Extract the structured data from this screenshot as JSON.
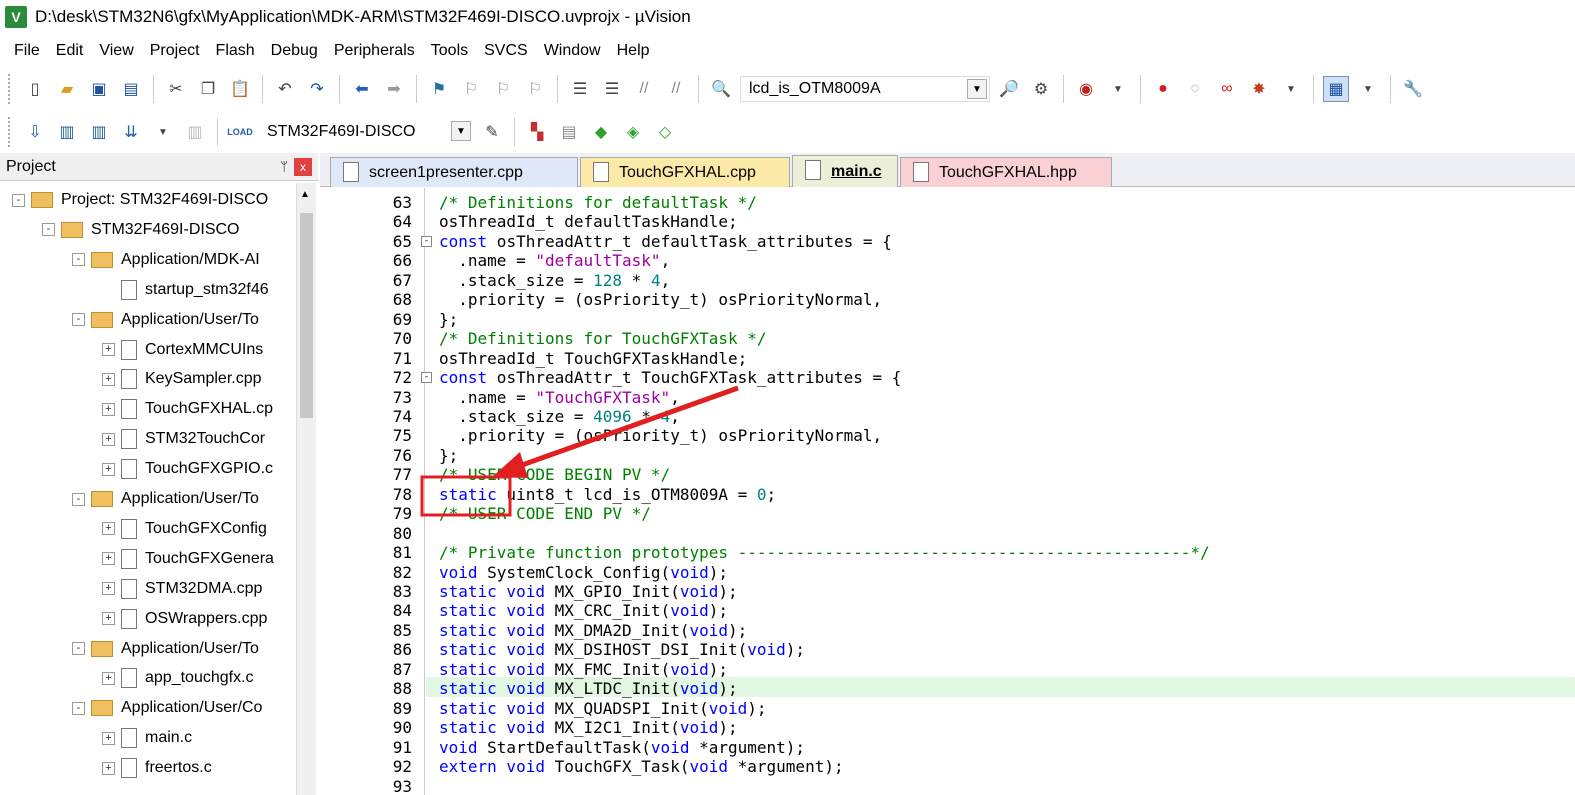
{
  "window": {
    "title": "D:\\desk\\STM32N6\\gfx\\MyApplication\\MDK-ARM\\STM32F469I-DISCO.uvprojx - µVision",
    "icon": "V"
  },
  "menu": [
    "File",
    "Edit",
    "View",
    "Project",
    "Flash",
    "Debug",
    "Peripherals",
    "Tools",
    "SVCS",
    "Window",
    "Help"
  ],
  "toolbar": {
    "find_combo": "lcd_is_OTM8009A",
    "target_combo": "STM32F469I-DISCO"
  },
  "project_panel": {
    "title": "Project",
    "pin": "ᛘ",
    "close": "x"
  },
  "tree": [
    {
      "label": "Project: STM32F469I-DISCO",
      "toggle": "-"
    },
    {
      "label": "STM32F469I-DISCO",
      "toggle": "-"
    },
    {
      "label": "Application/MDK-AI",
      "toggle": "-"
    },
    {
      "label": "startup_stm32f46",
      "toggle": ""
    },
    {
      "label": "Application/User/To",
      "toggle": "-"
    },
    {
      "label": "CortexMMCUIns",
      "toggle": "+"
    },
    {
      "label": "KeySampler.cpp",
      "toggle": "+"
    },
    {
      "label": "TouchGFXHAL.cp",
      "toggle": "+"
    },
    {
      "label": "STM32TouchCor",
      "toggle": "+"
    },
    {
      "label": "TouchGFXGPIO.c",
      "toggle": "+"
    },
    {
      "label": "Application/User/To",
      "toggle": "-"
    },
    {
      "label": "TouchGFXConfig",
      "toggle": "+"
    },
    {
      "label": "TouchGFXGenera",
      "toggle": "+"
    },
    {
      "label": "STM32DMA.cpp",
      "toggle": "+"
    },
    {
      "label": "OSWrappers.cpp",
      "toggle": "+"
    },
    {
      "label": "Application/User/To",
      "toggle": "-"
    },
    {
      "label": "app_touchgfx.c",
      "toggle": "+"
    },
    {
      "label": "Application/User/Co",
      "toggle": "-"
    },
    {
      "label": "main.c",
      "toggle": "+"
    },
    {
      "label": "freertos.c",
      "toggle": "+"
    }
  ],
  "tabs": [
    {
      "label": "screen1presenter.cpp",
      "active": false,
      "color": "#dfe8f8"
    },
    {
      "label": "TouchGFXHAL.cpp",
      "active": false,
      "color": "#fbe9a8"
    },
    {
      "label": "main.c",
      "active": true,
      "color": "#ecf0d8"
    },
    {
      "label": "TouchGFXHAL.hpp",
      "active": false,
      "color": "#f9d0d4"
    }
  ],
  "code": [
    {
      "n": "63",
      "f": "",
      "t": [
        [
          "cm",
          "/* Definitions for defaultTask */"
        ]
      ]
    },
    {
      "n": "64",
      "f": "",
      "t": [
        [
          "",
          "osThreadId_t defaultTaskHandle;"
        ]
      ]
    },
    {
      "n": "65",
      "f": "-",
      "t": [
        [
          "kw",
          "const"
        ],
        [
          "",
          " osThreadAttr_t defaultTask_attributes = {"
        ]
      ]
    },
    {
      "n": "66",
      "f": "",
      "t": [
        [
          "",
          "  .name = "
        ],
        [
          "st",
          "\"defaultTask\""
        ],
        [
          "",
          ","
        ]
      ]
    },
    {
      "n": "67",
      "f": "",
      "t": [
        [
          "",
          "  .stack_size = "
        ],
        [
          "nm",
          "128"
        ],
        [
          "",
          " * "
        ],
        [
          "nm",
          "4"
        ],
        [
          "",
          ","
        ]
      ]
    },
    {
      "n": "68",
      "f": "",
      "t": [
        [
          "",
          "  .priority = (osPriority_t) osPriorityNormal,"
        ]
      ]
    },
    {
      "n": "69",
      "f": "",
      "t": [
        [
          "",
          "};"
        ]
      ]
    },
    {
      "n": "70",
      "f": "",
      "t": [
        [
          "cm",
          "/* Definitions for TouchGFXTask */"
        ]
      ]
    },
    {
      "n": "71",
      "f": "",
      "t": [
        [
          "",
          "osThreadId_t TouchGFXTaskHandle;"
        ]
      ]
    },
    {
      "n": "72",
      "f": "-",
      "t": [
        [
          "kw",
          "const"
        ],
        [
          "",
          " osThreadAttr_t TouchGFXTask_attributes = {"
        ]
      ]
    },
    {
      "n": "73",
      "f": "",
      "t": [
        [
          "",
          "  .name = "
        ],
        [
          "st",
          "\"TouchGFXTask\""
        ],
        [
          "",
          ","
        ]
      ]
    },
    {
      "n": "74",
      "f": "",
      "t": [
        [
          "",
          "  .stack_size = "
        ],
        [
          "nm",
          "4096"
        ],
        [
          "",
          " * "
        ],
        [
          "nm",
          "4"
        ],
        [
          "",
          ","
        ]
      ]
    },
    {
      "n": "75",
      "f": "",
      "t": [
        [
          "",
          "  .priority = (osPriority_t) osPriorityNormal,"
        ]
      ]
    },
    {
      "n": "76",
      "f": "",
      "t": [
        [
          "",
          "};"
        ]
      ]
    },
    {
      "n": "77",
      "f": "",
      "t": [
        [
          "cm",
          "/* USER CODE BEGIN PV */"
        ]
      ]
    },
    {
      "n": "78",
      "f": "",
      "t": [
        [
          "kw",
          "static"
        ],
        [
          "",
          " uint8_t lcd_is_OTM8009A = "
        ],
        [
          "nm",
          "0"
        ],
        [
          "",
          ";"
        ]
      ]
    },
    {
      "n": "79",
      "f": "",
      "t": [
        [
          "cm",
          "/* USER CODE END PV */"
        ]
      ]
    },
    {
      "n": "80",
      "f": "",
      "t": []
    },
    {
      "n": "81",
      "f": "",
      "t": [
        [
          "cm",
          "/* Private function prototypes -----------------------------------------------*/"
        ]
      ]
    },
    {
      "n": "82",
      "f": "",
      "t": [
        [
          "kw",
          "void"
        ],
        [
          "",
          " SystemClock_Config("
        ],
        [
          "kw",
          "void"
        ],
        [
          "",
          ");"
        ]
      ]
    },
    {
      "n": "83",
      "f": "",
      "t": [
        [
          "kw",
          "static void"
        ],
        [
          "",
          " MX_GPIO_Init("
        ],
        [
          "kw",
          "void"
        ],
        [
          "",
          ");"
        ]
      ]
    },
    {
      "n": "84",
      "f": "",
      "t": [
        [
          "kw",
          "static void"
        ],
        [
          "",
          " MX_CRC_Init("
        ],
        [
          "kw",
          "void"
        ],
        [
          "",
          ");"
        ]
      ]
    },
    {
      "n": "85",
      "f": "",
      "t": [
        [
          "kw",
          "static void"
        ],
        [
          "",
          " MX_DMA2D_Init("
        ],
        [
          "kw",
          "void"
        ],
        [
          "",
          ");"
        ]
      ]
    },
    {
      "n": "86",
      "f": "",
      "t": [
        [
          "kw",
          "static void"
        ],
        [
          "",
          " MX_DSIHOST_DSI_Init("
        ],
        [
          "kw",
          "void"
        ],
        [
          "",
          ");"
        ]
      ]
    },
    {
      "n": "87",
      "f": "",
      "t": [
        [
          "kw",
          "static void"
        ],
        [
          "",
          " MX_FMC_Init("
        ],
        [
          "kw",
          "void"
        ],
        [
          "",
          ");"
        ]
      ]
    },
    {
      "n": "88",
      "f": "",
      "t": [
        [
          "kw",
          "static void"
        ],
        [
          "",
          " MX_LTDC_Init("
        ],
        [
          "kw",
          "void"
        ],
        [
          "",
          ");"
        ]
      ]
    },
    {
      "n": "89",
      "f": "",
      "t": [
        [
          "kw",
          "static void"
        ],
        [
          "",
          " MX_QUADSPI_Init("
        ],
        [
          "kw",
          "void"
        ],
        [
          "",
          ");"
        ]
      ]
    },
    {
      "n": "90",
      "f": "",
      "t": [
        [
          "kw",
          "static void"
        ],
        [
          "",
          " MX_I2C1_Init("
        ],
        [
          "kw",
          "void"
        ],
        [
          "",
          ");"
        ]
      ]
    },
    {
      "n": "91",
      "f": "",
      "t": [
        [
          "kw",
          "void"
        ],
        [
          "",
          " StartDefaultTask("
        ],
        [
          "kw",
          "void"
        ],
        [
          "",
          " *argument);"
        ]
      ]
    },
    {
      "n": "92",
      "f": "",
      "t": [
        [
          "kw",
          "extern void"
        ],
        [
          "",
          " TouchGFX_Task("
        ],
        [
          "kw",
          "void"
        ],
        [
          "",
          " *argument);"
        ]
      ]
    },
    {
      "n": "93",
      "f": "",
      "t": []
    }
  ],
  "annotation": {
    "color": "#e02020"
  }
}
